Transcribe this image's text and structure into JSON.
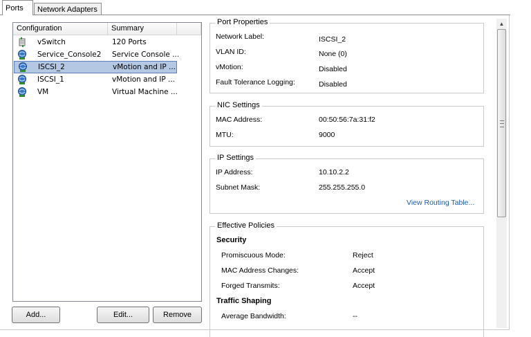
{
  "tabs": [
    {
      "label": "Ports",
      "active": true
    },
    {
      "label": "Network Adapters",
      "active": false
    }
  ],
  "list": {
    "columns": [
      "Configuration",
      "Summary"
    ],
    "rows": [
      {
        "icon": "vswitch-icon",
        "config": "vSwitch",
        "summary": "120 Ports"
      },
      {
        "icon": "port-group-icon",
        "config": "Service_Console2",
        "summary": "Service Console ..."
      },
      {
        "icon": "port-group-icon",
        "config": "ISCSI_2",
        "summary": "vMotion and IP ...",
        "selected": true
      },
      {
        "icon": "port-group-icon",
        "config": "ISCSI_1",
        "summary": "vMotion and IP ..."
      },
      {
        "icon": "port-group-icon",
        "config": "VM",
        "summary": "Virtual Machine ..."
      }
    ]
  },
  "buttons": {
    "add": "Add...",
    "edit": "Edit...",
    "remove": "Remove"
  },
  "port_properties": {
    "title": "Port Properties",
    "items": [
      {
        "label": "Network Label:",
        "value": "ISCSI_2"
      },
      {
        "label": "VLAN ID:",
        "value": "None (0)"
      },
      {
        "label": "vMotion:",
        "value": "Disabled"
      },
      {
        "label": "Fault Tolerance Logging:",
        "value": "Disabled"
      }
    ]
  },
  "nic_settings": {
    "title": "NIC Settings",
    "items": [
      {
        "label": "MAC Address:",
        "value": "00:50:56:7a:31:f2"
      },
      {
        "label": "MTU:",
        "value": "9000"
      }
    ]
  },
  "ip_settings": {
    "title": "IP Settings",
    "items": [
      {
        "label": "IP Address:",
        "value": "10.10.2.2"
      },
      {
        "label": "Subnet Mask:",
        "value": "255.255.255.0"
      }
    ],
    "link": "View Routing Table..."
  },
  "effective_policies": {
    "title": "Effective Policies",
    "security": {
      "heading": "Security",
      "items": [
        {
          "label": "Promiscuous Mode:",
          "value": "Reject"
        },
        {
          "label": "MAC Address Changes:",
          "value": "Accept"
        },
        {
          "label": "Forged Transmits:",
          "value": "Accept"
        }
      ]
    },
    "traffic_shaping": {
      "heading": "Traffic Shaping",
      "items": [
        {
          "label": "Average Bandwidth:",
          "value": "--"
        }
      ]
    }
  },
  "colors": {
    "selection": "#b4c8e4",
    "link": "#1e5aa8",
    "border": "#c9c9c9"
  }
}
